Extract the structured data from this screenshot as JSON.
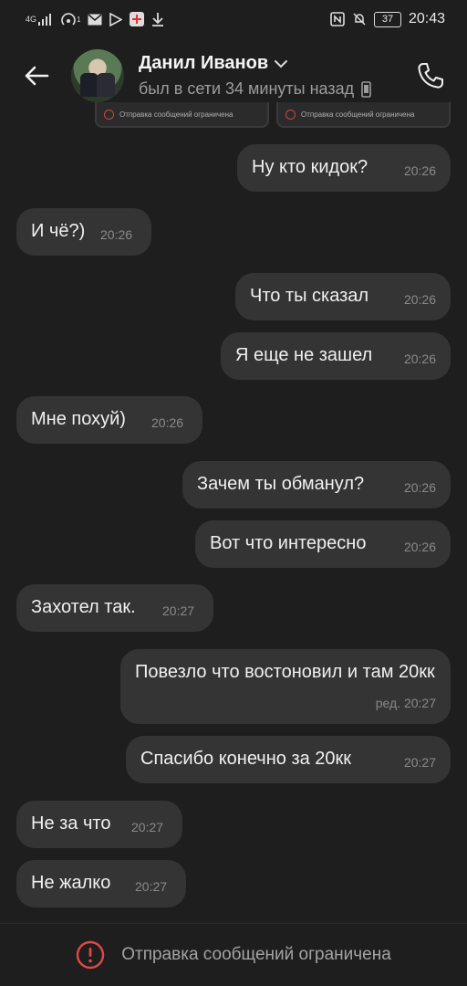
{
  "status_bar": {
    "network": "4G",
    "sim_count": "1",
    "battery": "37",
    "time": "20:43"
  },
  "header": {
    "contact_name": "Данил Иванов",
    "last_seen": "был в сети 34 минуты назад"
  },
  "previous_cards": [
    {
      "text": "Отправка сообщений ограничена"
    },
    {
      "text": "Отправка сообщений ограничена"
    }
  ],
  "messages": [
    {
      "dir": "out",
      "text": "Ну кто кидок?",
      "time": "20:26"
    },
    {
      "dir": "in",
      "text": "И чё?)",
      "time": "20:26"
    },
    {
      "dir": "out",
      "text": "Что ты сказал",
      "time": "20:26"
    },
    {
      "dir": "out",
      "text": "Я еще не зашел",
      "time": "20:26"
    },
    {
      "dir": "in",
      "text": "Мне похуй)",
      "time": "20:26"
    },
    {
      "dir": "out",
      "text": "Зачем ты обманул?",
      "time": "20:26"
    },
    {
      "dir": "out",
      "text": "Вот что интересно",
      "time": "20:26"
    },
    {
      "dir": "in",
      "text": "Захотел так.",
      "time": "20:27"
    },
    {
      "dir": "out",
      "text": "Повезло что востоновил и там 20кк",
      "time": "ред. 20:27"
    },
    {
      "dir": "out",
      "text": "Спасибо конечно за 20кк",
      "time": "20:27"
    },
    {
      "dir": "in",
      "text": "Не за что",
      "time": "20:27"
    },
    {
      "dir": "in",
      "text": "Не жалко",
      "time": "20:27"
    }
  ],
  "bottom_bar": {
    "text": "Отправка сообщений ограничена"
  },
  "colors": {
    "background": "#1e1e1e",
    "bubble": "#343434",
    "warning": "#e04848"
  }
}
